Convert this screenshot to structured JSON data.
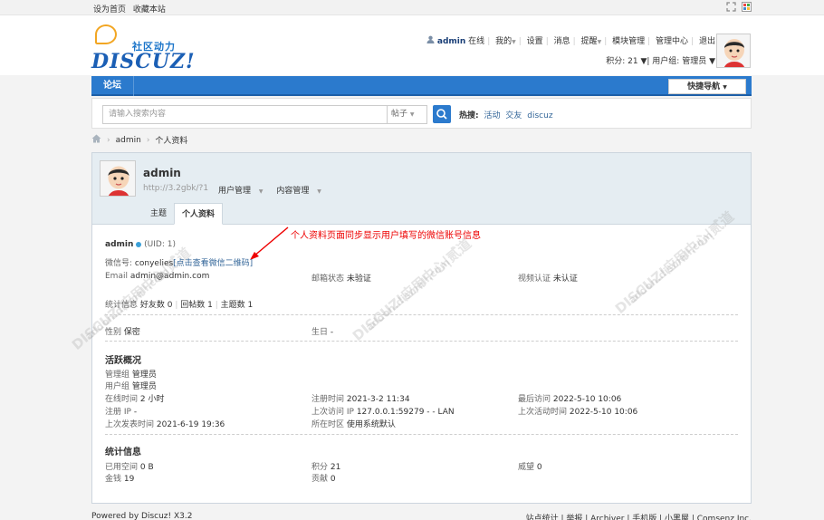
{
  "topbar": {
    "set_home": "设为首页",
    "bookmark": "收藏本站"
  },
  "logo": {
    "cn": "社区动力",
    "en": "DISCUZ!"
  },
  "user": {
    "name": "admin",
    "status": "在线",
    "my": "我的",
    "settings": "设置",
    "messages": "消息",
    "reminders": "提醒",
    "block_manage": "模块管理",
    "admin_center": "管理中心",
    "logout": "退出",
    "points": "积分: 21",
    "group": "用户组: 管理员"
  },
  "nav": {
    "forum": "论坛",
    "quick_nav": "快捷导航"
  },
  "search": {
    "placeholder": "请输入搜索内容",
    "type": "帖子",
    "hot_label": "热搜:",
    "hot": [
      "活动",
      "交友",
      "discuz"
    ]
  },
  "breadcrumb": {
    "user": "admin",
    "page": "个人资料"
  },
  "profile": {
    "name": "admin",
    "url": "http://3.2gbk/?1",
    "menu_user": "用户管理",
    "menu_content": "内容管理",
    "tabs": [
      "主题",
      "个人资料"
    ],
    "annotation": "个人资料页面同步显示用户填写的微信账号信息",
    "uid": "(UID: 1)",
    "wechat_label": "微信号:",
    "wechat_value": "conyelies",
    "wechat_link": "[点击查看微信二维码]",
    "email_label": "Email",
    "email_value": "admin@admin.com",
    "email_status_label": "邮箱状态",
    "email_status_value": "未验证",
    "video_label": "视频认证",
    "video_value": "未认证",
    "stats_label": "统计信息",
    "friends": "好友数 0",
    "replies": "回帖数 1",
    "threads": "主题数 1",
    "gender_label": "性别",
    "gender_value": "保密",
    "birthday_label": "生日",
    "birthday_value": "-",
    "activity_title": "活跃概况",
    "admin_group_label": "管理组",
    "admin_group_value": "管理员",
    "user_group_label": "用户组",
    "user_group_value": "管理员",
    "online_label": "在线时间",
    "online_value": "2 小时",
    "reg_time_label": "注册时间",
    "reg_time_value": "2021-3-2 11:34",
    "last_visit_label": "最后访问",
    "last_visit_value": "2022-5-10 10:06",
    "reg_ip_label": "注册 IP",
    "reg_ip_value": "-",
    "last_ip_label": "上次访问 IP",
    "last_ip_value": "127.0.0.1:59279 - - LAN",
    "last_active_label": "上次活动时间",
    "last_active_value": "2022-5-10 10:06",
    "last_post_label": "上次发表时间",
    "last_post_value": "2021-6-19 19:36",
    "tz_label": "所在时区",
    "tz_value": "使用系统默认",
    "stats_title": "统计信息",
    "space_label": "已用空间",
    "space_value": "0 B",
    "credits_label": "积分",
    "credits_value": "21",
    "prestige_label": "威望",
    "prestige_value": "0",
    "money_label": "金钱",
    "money_value": "19",
    "contrib_label": "贡献",
    "contrib_value": "0"
  },
  "watermark": {
    "text": "DISCUZ!应用中心|贰道",
    "sub": "addon.dismall.com"
  },
  "footer": {
    "left": "Powered by Discuz! X3.2",
    "right": "站点统计 | 举报 | Archiver | 手机版 | 小黑屋 | Comsenz Inc."
  }
}
